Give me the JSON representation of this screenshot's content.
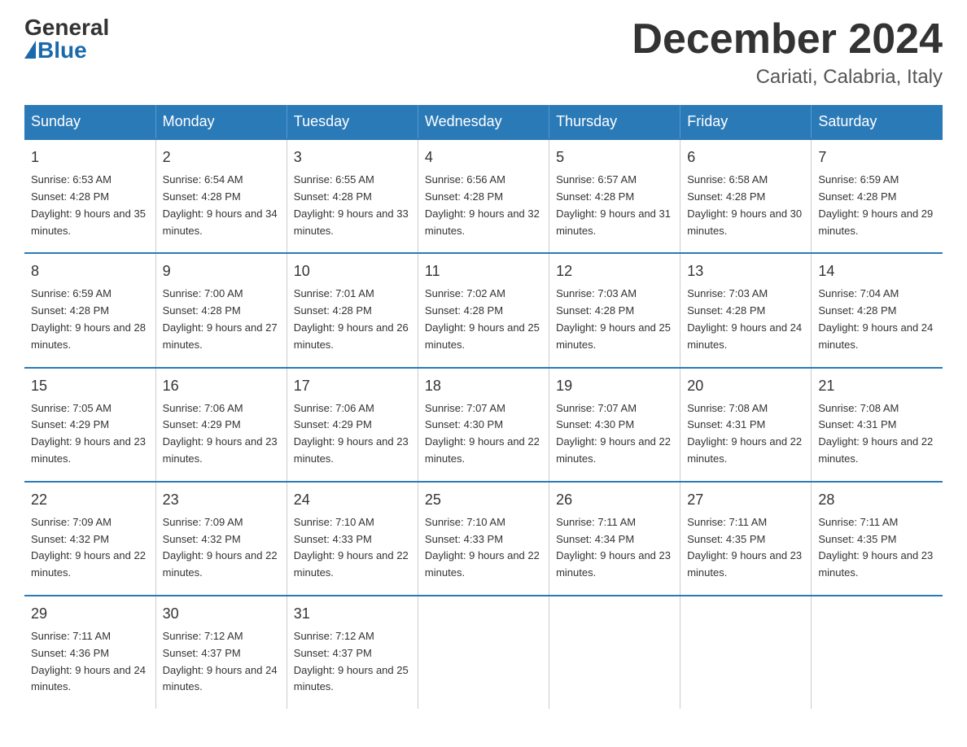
{
  "logo": {
    "general": "General",
    "blue": "Blue"
  },
  "title": "December 2024",
  "location": "Cariati, Calabria, Italy",
  "days_of_week": [
    "Sunday",
    "Monday",
    "Tuesday",
    "Wednesday",
    "Thursday",
    "Friday",
    "Saturday"
  ],
  "weeks": [
    [
      {
        "day": "1",
        "sunrise": "Sunrise: 6:53 AM",
        "sunset": "Sunset: 4:28 PM",
        "daylight": "Daylight: 9 hours and 35 minutes."
      },
      {
        "day": "2",
        "sunrise": "Sunrise: 6:54 AM",
        "sunset": "Sunset: 4:28 PM",
        "daylight": "Daylight: 9 hours and 34 minutes."
      },
      {
        "day": "3",
        "sunrise": "Sunrise: 6:55 AM",
        "sunset": "Sunset: 4:28 PM",
        "daylight": "Daylight: 9 hours and 33 minutes."
      },
      {
        "day": "4",
        "sunrise": "Sunrise: 6:56 AM",
        "sunset": "Sunset: 4:28 PM",
        "daylight": "Daylight: 9 hours and 32 minutes."
      },
      {
        "day": "5",
        "sunrise": "Sunrise: 6:57 AM",
        "sunset": "Sunset: 4:28 PM",
        "daylight": "Daylight: 9 hours and 31 minutes."
      },
      {
        "day": "6",
        "sunrise": "Sunrise: 6:58 AM",
        "sunset": "Sunset: 4:28 PM",
        "daylight": "Daylight: 9 hours and 30 minutes."
      },
      {
        "day": "7",
        "sunrise": "Sunrise: 6:59 AM",
        "sunset": "Sunset: 4:28 PM",
        "daylight": "Daylight: 9 hours and 29 minutes."
      }
    ],
    [
      {
        "day": "8",
        "sunrise": "Sunrise: 6:59 AM",
        "sunset": "Sunset: 4:28 PM",
        "daylight": "Daylight: 9 hours and 28 minutes."
      },
      {
        "day": "9",
        "sunrise": "Sunrise: 7:00 AM",
        "sunset": "Sunset: 4:28 PM",
        "daylight": "Daylight: 9 hours and 27 minutes."
      },
      {
        "day": "10",
        "sunrise": "Sunrise: 7:01 AM",
        "sunset": "Sunset: 4:28 PM",
        "daylight": "Daylight: 9 hours and 26 minutes."
      },
      {
        "day": "11",
        "sunrise": "Sunrise: 7:02 AM",
        "sunset": "Sunset: 4:28 PM",
        "daylight": "Daylight: 9 hours and 25 minutes."
      },
      {
        "day": "12",
        "sunrise": "Sunrise: 7:03 AM",
        "sunset": "Sunset: 4:28 PM",
        "daylight": "Daylight: 9 hours and 25 minutes."
      },
      {
        "day": "13",
        "sunrise": "Sunrise: 7:03 AM",
        "sunset": "Sunset: 4:28 PM",
        "daylight": "Daylight: 9 hours and 24 minutes."
      },
      {
        "day": "14",
        "sunrise": "Sunrise: 7:04 AM",
        "sunset": "Sunset: 4:28 PM",
        "daylight": "Daylight: 9 hours and 24 minutes."
      }
    ],
    [
      {
        "day": "15",
        "sunrise": "Sunrise: 7:05 AM",
        "sunset": "Sunset: 4:29 PM",
        "daylight": "Daylight: 9 hours and 23 minutes."
      },
      {
        "day": "16",
        "sunrise": "Sunrise: 7:06 AM",
        "sunset": "Sunset: 4:29 PM",
        "daylight": "Daylight: 9 hours and 23 minutes."
      },
      {
        "day": "17",
        "sunrise": "Sunrise: 7:06 AM",
        "sunset": "Sunset: 4:29 PM",
        "daylight": "Daylight: 9 hours and 23 minutes."
      },
      {
        "day": "18",
        "sunrise": "Sunrise: 7:07 AM",
        "sunset": "Sunset: 4:30 PM",
        "daylight": "Daylight: 9 hours and 22 minutes."
      },
      {
        "day": "19",
        "sunrise": "Sunrise: 7:07 AM",
        "sunset": "Sunset: 4:30 PM",
        "daylight": "Daylight: 9 hours and 22 minutes."
      },
      {
        "day": "20",
        "sunrise": "Sunrise: 7:08 AM",
        "sunset": "Sunset: 4:31 PM",
        "daylight": "Daylight: 9 hours and 22 minutes."
      },
      {
        "day": "21",
        "sunrise": "Sunrise: 7:08 AM",
        "sunset": "Sunset: 4:31 PM",
        "daylight": "Daylight: 9 hours and 22 minutes."
      }
    ],
    [
      {
        "day": "22",
        "sunrise": "Sunrise: 7:09 AM",
        "sunset": "Sunset: 4:32 PM",
        "daylight": "Daylight: 9 hours and 22 minutes."
      },
      {
        "day": "23",
        "sunrise": "Sunrise: 7:09 AM",
        "sunset": "Sunset: 4:32 PM",
        "daylight": "Daylight: 9 hours and 22 minutes."
      },
      {
        "day": "24",
        "sunrise": "Sunrise: 7:10 AM",
        "sunset": "Sunset: 4:33 PM",
        "daylight": "Daylight: 9 hours and 22 minutes."
      },
      {
        "day": "25",
        "sunrise": "Sunrise: 7:10 AM",
        "sunset": "Sunset: 4:33 PM",
        "daylight": "Daylight: 9 hours and 22 minutes."
      },
      {
        "day": "26",
        "sunrise": "Sunrise: 7:11 AM",
        "sunset": "Sunset: 4:34 PM",
        "daylight": "Daylight: 9 hours and 23 minutes."
      },
      {
        "day": "27",
        "sunrise": "Sunrise: 7:11 AM",
        "sunset": "Sunset: 4:35 PM",
        "daylight": "Daylight: 9 hours and 23 minutes."
      },
      {
        "day": "28",
        "sunrise": "Sunrise: 7:11 AM",
        "sunset": "Sunset: 4:35 PM",
        "daylight": "Daylight: 9 hours and 23 minutes."
      }
    ],
    [
      {
        "day": "29",
        "sunrise": "Sunrise: 7:11 AM",
        "sunset": "Sunset: 4:36 PM",
        "daylight": "Daylight: 9 hours and 24 minutes."
      },
      {
        "day": "30",
        "sunrise": "Sunrise: 7:12 AM",
        "sunset": "Sunset: 4:37 PM",
        "daylight": "Daylight: 9 hours and 24 minutes."
      },
      {
        "day": "31",
        "sunrise": "Sunrise: 7:12 AM",
        "sunset": "Sunset: 4:37 PM",
        "daylight": "Daylight: 9 hours and 25 minutes."
      },
      {
        "day": "",
        "sunrise": "",
        "sunset": "",
        "daylight": ""
      },
      {
        "day": "",
        "sunrise": "",
        "sunset": "",
        "daylight": ""
      },
      {
        "day": "",
        "sunrise": "",
        "sunset": "",
        "daylight": ""
      },
      {
        "day": "",
        "sunrise": "",
        "sunset": "",
        "daylight": ""
      }
    ]
  ]
}
